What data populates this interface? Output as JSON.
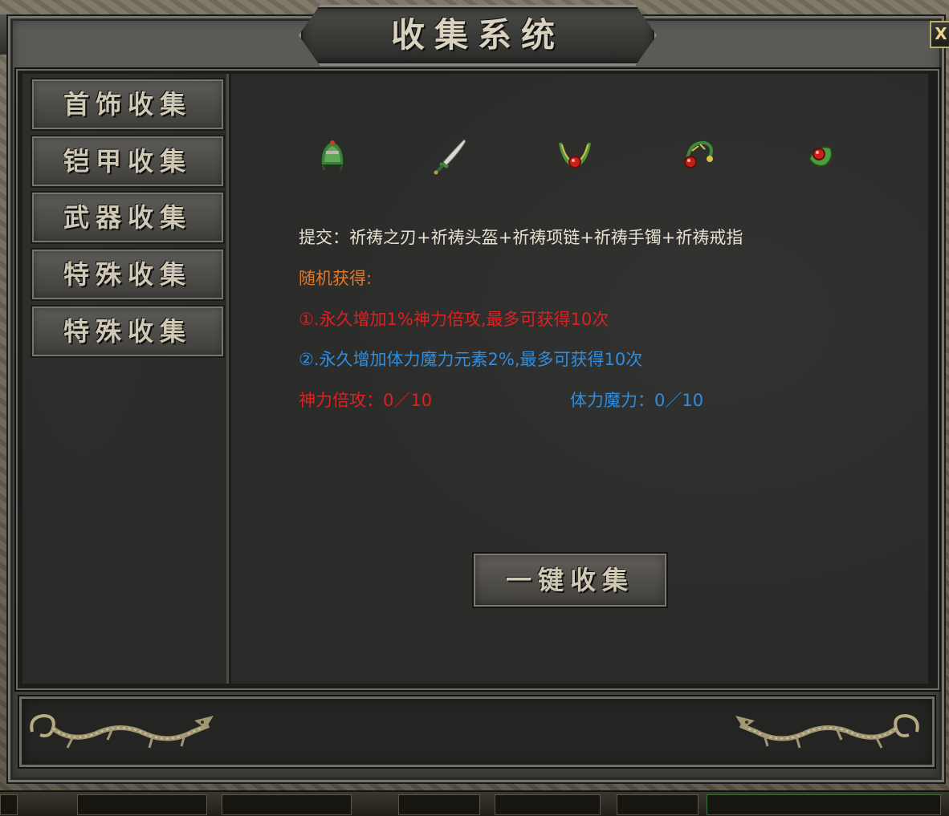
{
  "window": {
    "title": "收集系统",
    "close_label": "X"
  },
  "sidebar": {
    "tabs": [
      {
        "label": "首饰收集"
      },
      {
        "label": "铠甲收集"
      },
      {
        "label": "武器收集"
      },
      {
        "label": "特殊收集"
      },
      {
        "label": "特殊收集"
      }
    ]
  },
  "items": [
    {
      "icon": "green-helmet-icon"
    },
    {
      "icon": "sword-icon"
    },
    {
      "icon": "necklace-icon"
    },
    {
      "icon": "bracelet-icon"
    },
    {
      "icon": "ring-icon"
    }
  ],
  "info": {
    "submit": "提交：祈祷之刃+祈祷头盔+祈祷项链+祈祷手镯+祈祷戒指",
    "random_title": "随机获得:",
    "reward_1": "①.永久增加1%神力倍攻,最多可获得10次",
    "reward_2": "②.永久增加体力魔力元素2%,最多可获得10次",
    "progress_1": "神力倍攻：0／10",
    "progress_2": "体力魔力：0／10"
  },
  "actions": {
    "collect_all": "一键收集"
  },
  "colors": {
    "orange": "#e0782c",
    "red": "#e02020",
    "blue": "#2f8ee0",
    "white": "#e6e0cf"
  }
}
